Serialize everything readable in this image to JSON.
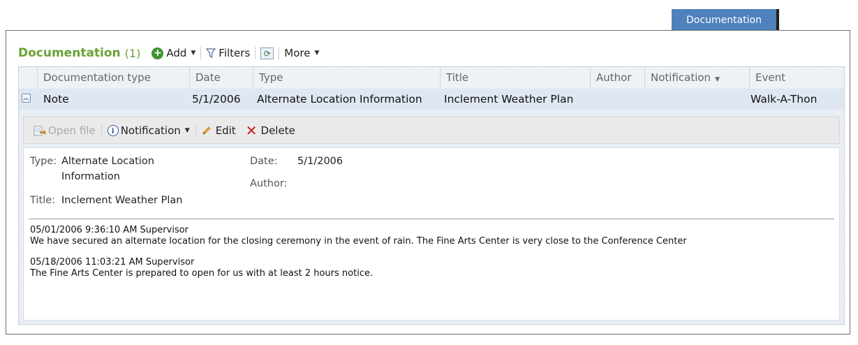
{
  "tab": {
    "label": "Documentation"
  },
  "header": {
    "title": "Documentation",
    "count": "(1)",
    "add_label": "Add",
    "filters_label": "Filters",
    "more_label": "More"
  },
  "columns": [
    "Documentation type",
    "Date",
    "Type",
    "Title",
    "Author",
    "Notification",
    "Event"
  ],
  "row": {
    "documentation_type": "Note",
    "date": "5/1/2006",
    "type": "Alternate Location Information",
    "title": "Inclement Weather Plan",
    "author": "",
    "notification": "",
    "event": "Walk-A-Thon"
  },
  "detail_toolbar": {
    "open_file_label": "Open file",
    "notification_label": "Notification",
    "edit_label": "Edit",
    "delete_label": "Delete"
  },
  "detail": {
    "type_label": "Type:",
    "type_value_line1": "Alternate Location",
    "type_value_line2": "Information",
    "title_label": "Title:",
    "title_value": "Inclement Weather Plan",
    "date_label": "Date:",
    "date_value": "5/1/2006",
    "author_label": "Author:",
    "notes": [
      {
        "header": "05/01/2006 9:36:10 AM Supervisor",
        "text": "We have secured an alternate location for the closing ceremony in the event of rain. The Fine Arts Center is very close to the Conference Center"
      },
      {
        "header": "05/18/2006 11:03:21 AM Supervisor",
        "text": "The Fine Arts Center is prepared to open for us with at least 2 hours notice."
      }
    ]
  },
  "colors": {
    "accent_green": "#6aa336",
    "tab_blue": "#4f81bd",
    "delete_red": "#cc1c1c"
  }
}
